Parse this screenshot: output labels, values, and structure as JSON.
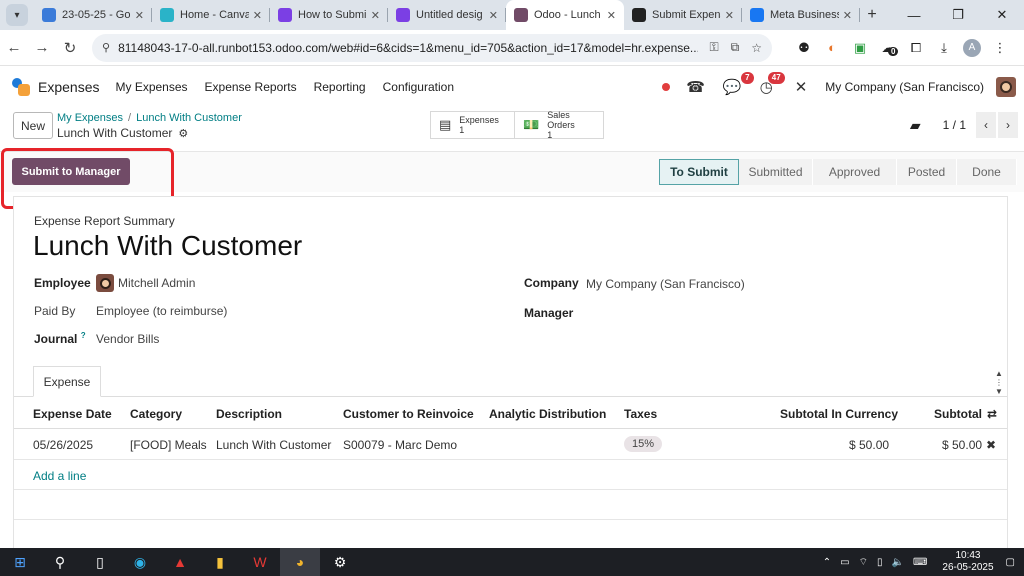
{
  "browser": {
    "tabs": [
      {
        "label": "23-05-25 - Go",
        "icon_color": "#3b7bd9",
        "active": false
      },
      {
        "label": "Home - Canva",
        "icon_color": "#2ab3c8",
        "active": false
      },
      {
        "label": "How to Submi",
        "icon_color": "#7b3fe4",
        "active": false
      },
      {
        "label": "Untitled desig",
        "icon_color": "#7b3fe4",
        "active": false
      },
      {
        "label": "Odoo - Lunch",
        "icon_color": "#714b67",
        "active": true
      },
      {
        "label": "Submit Expens",
        "icon_color": "#222222",
        "active": false
      },
      {
        "label": "Meta Business",
        "icon_color": "#1877f2",
        "active": false
      }
    ],
    "url": "81148043-17-0-all.runbot153.odoo.com/web#id=6&cids=1&menu_id=705&action_id=17&model=hr.expense....",
    "extension_badge": "0",
    "profile_initial": "A"
  },
  "odoo": {
    "app_name": "Expenses",
    "menu": [
      "My Expenses",
      "Expense Reports",
      "Reporting",
      "Configuration"
    ],
    "messages_count": "7",
    "activities_count": "47",
    "company": "My Company (San Francisco)"
  },
  "control": {
    "new_label": "New",
    "breadcrumb_parent": "My Expenses",
    "breadcrumb_current": "Lunch With Customer",
    "record_name": "Lunch With Customer",
    "smart_expenses_label": "Expenses",
    "smart_expenses_count": "1",
    "smart_so_label": "Sales Orders",
    "smart_so_count": "1",
    "pager": "1 / 1"
  },
  "actions": {
    "submit_label": "Submit to Manager",
    "stages": [
      "To Submit",
      "Submitted",
      "Approved",
      "Posted",
      "Done"
    ],
    "active_stage": "To Submit"
  },
  "form": {
    "subtitle": "Expense Report Summary",
    "title": "Lunch With Customer",
    "employee_label": "Employee",
    "employee_value": "Mitchell Admin",
    "paid_by_label": "Paid By",
    "paid_by_value": "Employee (to reimburse)",
    "journal_label": "Journal",
    "journal_help": "?",
    "journal_value": "Vendor Bills",
    "company_label": "Company",
    "company_value": "My Company (San Francisco)",
    "manager_label": "Manager",
    "manager_value": ""
  },
  "notebook": {
    "tab_label": "Expense"
  },
  "lines": {
    "headers": [
      "Expense Date",
      "Category",
      "Description",
      "Customer to Reinvoice",
      "Analytic Distribution",
      "Taxes",
      "Subtotal In Currency",
      "Subtotal"
    ],
    "rows": [
      {
        "date": "05/26/2025",
        "category": "[FOOD] Meals",
        "description": "Lunch With Customer",
        "customer": "S00079 - Marc Demo",
        "analytic": "",
        "taxes": "15%",
        "subtotal_currency": "$ 50.00",
        "subtotal": "$ 50.00"
      }
    ],
    "add_line": "Add a line"
  },
  "taskbar": {
    "time": "10:43",
    "date": "26-05-2025"
  },
  "colors": {
    "primary": "#714b67",
    "link": "#017e84",
    "highlight": "#e6242a"
  }
}
